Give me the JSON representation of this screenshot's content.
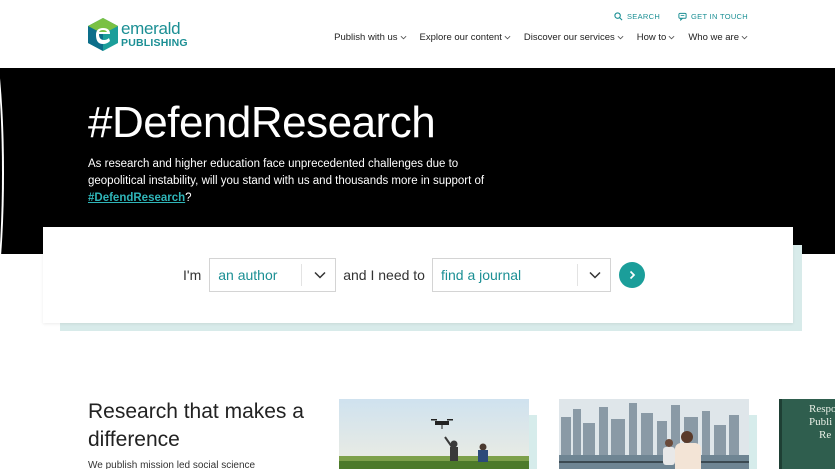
{
  "brand": {
    "line1": "emerald",
    "line2": "PUBLISHING",
    "color": "#1b8f94"
  },
  "util": {
    "search": "SEARCH",
    "contact": "GET IN TOUCH"
  },
  "nav": [
    {
      "label": "Publish with us"
    },
    {
      "label": "Explore our content"
    },
    {
      "label": "Discover our services"
    },
    {
      "label": "How to"
    },
    {
      "label": "Who we are"
    }
  ],
  "hero": {
    "title": "#DefendResearch",
    "body": "As research and higher education face unprecedented challenges due to geopolitical instability, will you stand with us and thousands more in support of ",
    "link": "#DefendResearch",
    "tail": "?"
  },
  "finder": {
    "label_im": "I'm",
    "role": "an author",
    "label_need": "and I need to",
    "task": "find a journal"
  },
  "section": {
    "title": "Research that makes a difference",
    "text": "We publish mission led social science"
  },
  "book": {
    "l1": "Respo",
    "l2": "Publi",
    "l3": "Re"
  },
  "colors": {
    "accent": "#1b9e9a",
    "hero_bg": "#000000",
    "card_accent": "#d6eceb"
  }
}
